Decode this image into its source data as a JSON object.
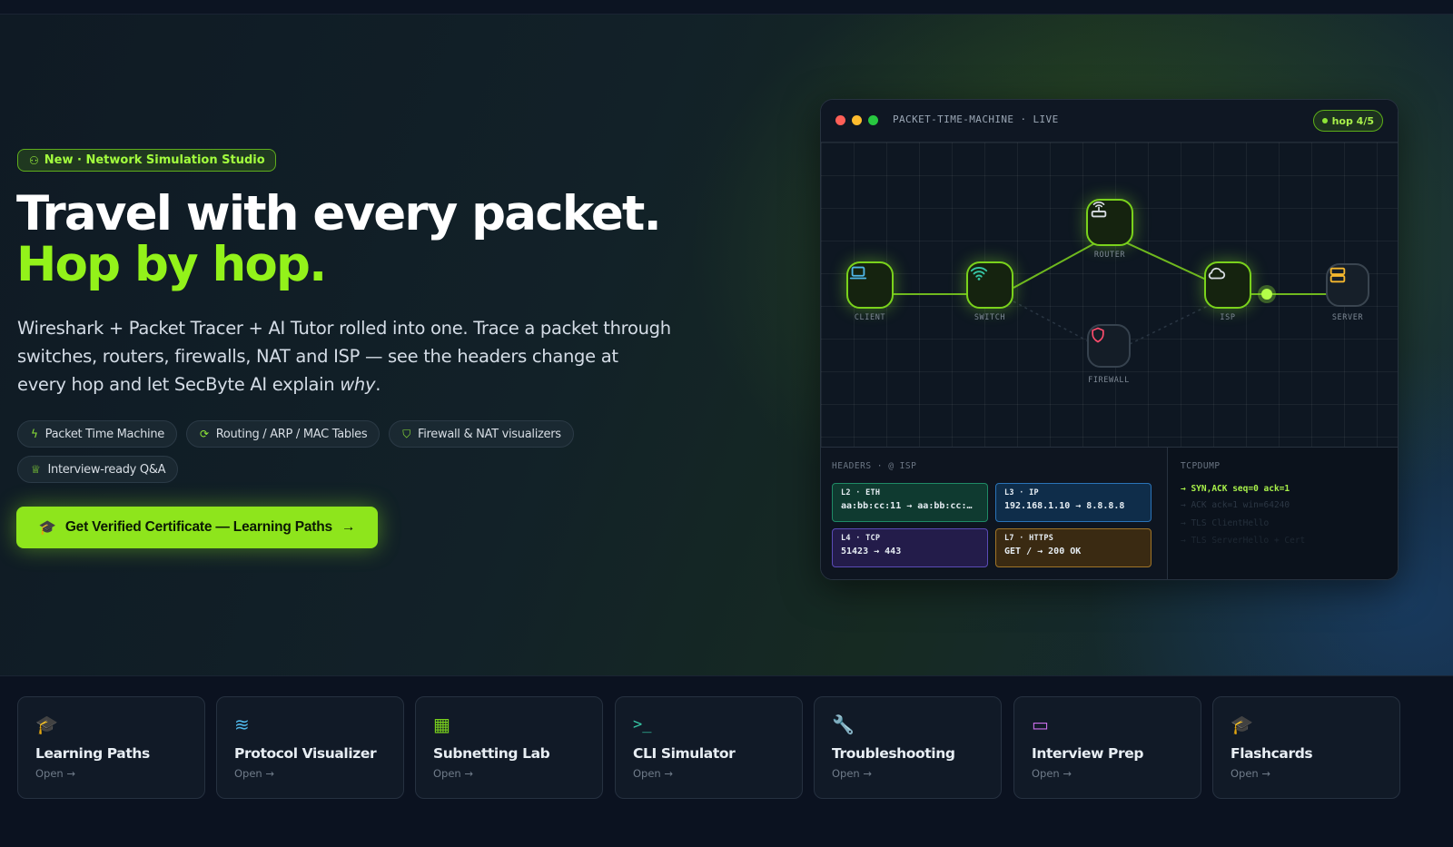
{
  "badge": {
    "icon": "network-icon",
    "label": "New · Network Simulation Studio"
  },
  "headline": {
    "line1": "Travel with every packet.",
    "line2": "Hop by hop."
  },
  "description": {
    "text": "Wireshark + Packet Tracer + AI Tutor rolled into one. Trace a packet through switches, routers, firewalls, NAT and ISP — see the headers change at every hop and let SecByte AI explain ",
    "emphasis": "why",
    "end": "."
  },
  "chips": [
    {
      "icon": "lightning-icon",
      "label": "Packet Time Machine"
    },
    {
      "icon": "refresh-icon",
      "label": "Routing / ARP / MAC Tables"
    },
    {
      "icon": "shield-icon",
      "label": "Firewall & NAT visualizers"
    },
    {
      "icon": "trophy-icon",
      "label": "Interview-ready Q&A"
    }
  ],
  "cta": {
    "icon": "graduation-cap-icon",
    "label": "Get Verified Certificate — Learning Paths",
    "arrow": "→"
  },
  "simulator": {
    "title": "PACKET-TIME-MACHINE · LIVE",
    "hop_badge": "hop 4/5",
    "hop_current": 4,
    "hop_total": 5,
    "colors": {
      "red": "#ff5f57",
      "yellow": "#febc2e",
      "green": "#28c840",
      "accent": "#8ee636"
    },
    "nodes": [
      {
        "id": "client",
        "label": "CLIENT",
        "icon": "laptop-icon",
        "active": true
      },
      {
        "id": "switch",
        "label": "SWITCH",
        "icon": "wifi-icon",
        "active": true
      },
      {
        "id": "router",
        "label": "ROUTER",
        "icon": "router-icon",
        "active": true
      },
      {
        "id": "isp",
        "label": "ISP",
        "icon": "cloud-icon",
        "active": true
      },
      {
        "id": "server",
        "label": "SERVER",
        "icon": "server-icon",
        "active": false
      },
      {
        "id": "firewall",
        "label": "FIREWALL",
        "icon": "shield-icon",
        "active": false
      }
    ],
    "headers_title": "HEADERS · @ ISP",
    "headers": [
      {
        "key": "L2 · ETH",
        "value": "aa:bb:cc:11 → aa:bb:cc:…",
        "color": "#0f3a30",
        "border": "#1f8a66"
      },
      {
        "key": "L3 · IP",
        "value": "192.168.1.10 → 8.8.8.8",
        "color": "#0f2d4a",
        "border": "#2a73b8"
      },
      {
        "key": "L4 · TCP",
        "value": "51423 → 443",
        "color": "#231c4a",
        "border": "#5a4bb5"
      },
      {
        "key": "L7 · HTTPS",
        "value": "GET / → 200 OK",
        "color": "#3a2a12",
        "border": "#a07428"
      }
    ],
    "tcpdump_title": "TCPDUMP",
    "tcpdump": [
      "→ SYN,ACK seq=0 ack=1",
      "→ ACK ack=1 win=64240",
      "→ TLS ClientHello",
      "→ TLS ServerHello + Cert"
    ]
  },
  "tools": [
    {
      "icon": "graduation-cap-icon",
      "glyph": "🎓",
      "color": "#f5b82e",
      "title": "Learning Paths",
      "action": "Open →"
    },
    {
      "icon": "layers-icon",
      "glyph": "≋",
      "color": "#4fb6e8",
      "title": "Protocol Visualizer",
      "action": "Open →"
    },
    {
      "icon": "calculator-icon",
      "glyph": "▦",
      "color": "#7ad21c",
      "title": "Subnetting Lab",
      "action": "Open →"
    },
    {
      "icon": "terminal-icon",
      "glyph": ">_",
      "color": "#36c7a6",
      "title": "CLI Simulator",
      "action": "Open →"
    },
    {
      "icon": "wrench-icon",
      "glyph": "🔧",
      "color": "#f5a623",
      "title": "Troubleshooting",
      "action": "Open →"
    },
    {
      "icon": "chat-icon",
      "glyph": "▭",
      "color": "#c96ee8",
      "title": "Interview Prep",
      "action": "Open →"
    },
    {
      "icon": "graduation-cap-icon",
      "glyph": "🎓",
      "color": "#4fd0e8",
      "title": "Flashcards",
      "action": "Open →"
    }
  ]
}
